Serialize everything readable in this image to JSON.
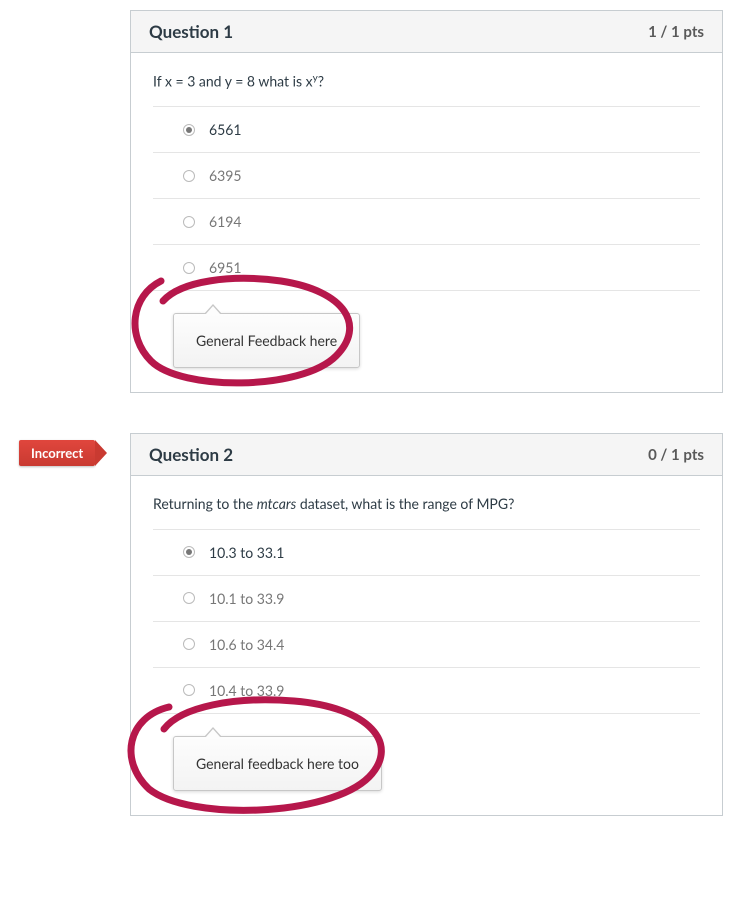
{
  "questions": [
    {
      "title": "Question 1",
      "points": "1 / 1 pts",
      "prompt_html": "If x = 3 and y = 8 what is x<sup>y</sup>?",
      "badge": null,
      "answers": [
        {
          "text": "6561",
          "selected": true
        },
        {
          "text": "6395",
          "selected": false
        },
        {
          "text": "6194",
          "selected": false
        },
        {
          "text": "6951",
          "selected": false
        }
      ],
      "feedback": "General Feedback here"
    },
    {
      "title": "Question 2",
      "points": "0 / 1 pts",
      "prompt_html": "Returning to the <em>mtcars</em> dataset, what is the range of MPG?",
      "badge": "Incorrect",
      "answers": [
        {
          "text": "10.3 to 33.1",
          "selected": true
        },
        {
          "text": "10.1 to 33.9",
          "selected": false
        },
        {
          "text": "10.6 to 34.4",
          "selected": false
        },
        {
          "text": "10.4 to 33.9",
          "selected": false
        }
      ],
      "feedback": "General feedback here too"
    }
  ],
  "annotation_color": "#b6174b"
}
